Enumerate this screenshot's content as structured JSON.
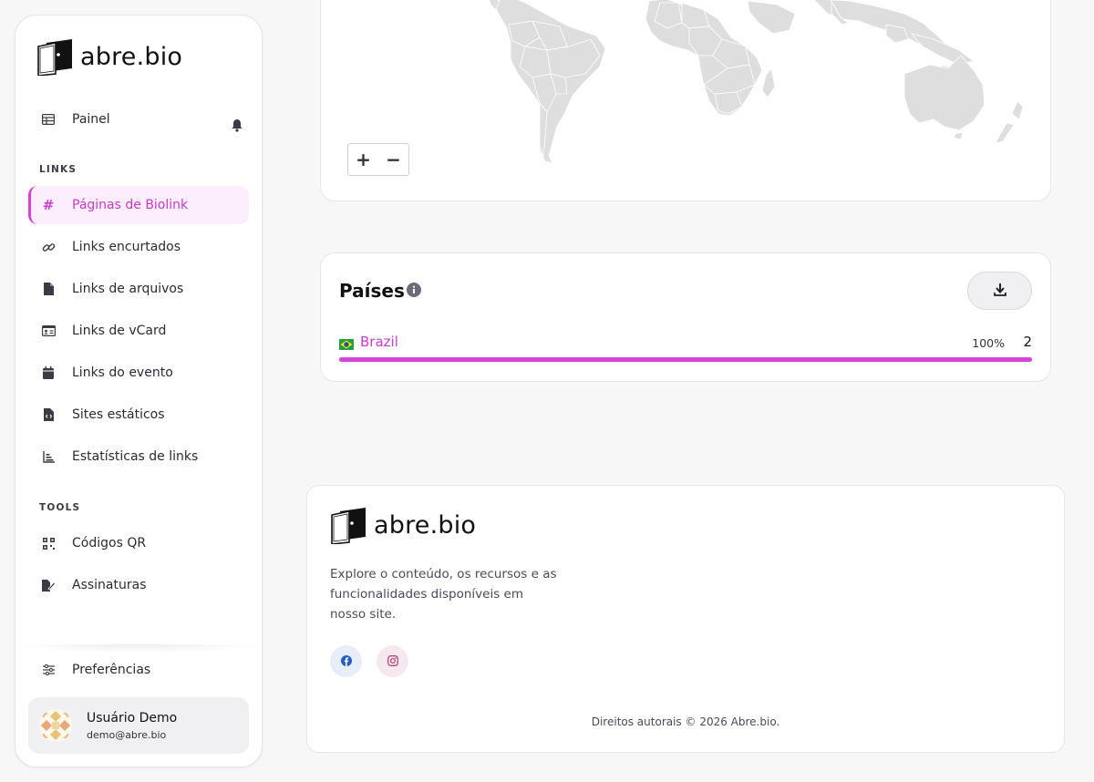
{
  "brand": {
    "name": "abre.bio"
  },
  "sidebar": {
    "dashboard_label": "Painel",
    "section_links": "LINKS",
    "section_tools": "TOOLS",
    "links": [
      {
        "label": "Páginas de Biolink",
        "icon": "hash-icon",
        "active": true
      },
      {
        "label": "Links encurtados",
        "icon": "link-icon"
      },
      {
        "label": "Links de arquivos",
        "icon": "file-icon"
      },
      {
        "label": "Links de vCard",
        "icon": "id-card-icon"
      },
      {
        "label": "Links do evento",
        "icon": "calendar-icon"
      },
      {
        "label": "Sites estáticos",
        "icon": "file-code-icon"
      },
      {
        "label": "Estatísticas de links",
        "icon": "chart-bar-icon"
      }
    ],
    "tools": [
      {
        "label": "Códigos QR",
        "icon": "qrcode-icon"
      },
      {
        "label": "Assinaturas",
        "icon": "signature-icon"
      }
    ],
    "preferences_label": "Preferências",
    "user": {
      "name": "Usuário Demo",
      "email": "demo@abre.bio"
    }
  },
  "map": {
    "zoom_in": "+",
    "zoom_out": "−"
  },
  "countries": {
    "title": "Países",
    "rows": [
      {
        "country": "Brazil",
        "flag": "brazil-flag-icon",
        "percent": "100%",
        "fraction": 1.0,
        "count": "2"
      }
    ]
  },
  "footer": {
    "description": "Explore o conteúdo, os recursos e as funcionalidades disponíveis em nosso site.",
    "copyright": "Direitos autorais © 2026 Abre.bio."
  },
  "colors": {
    "accent": "#d543d8",
    "accent_text": "#c93acb",
    "accent_bg": "#fdeefd"
  }
}
